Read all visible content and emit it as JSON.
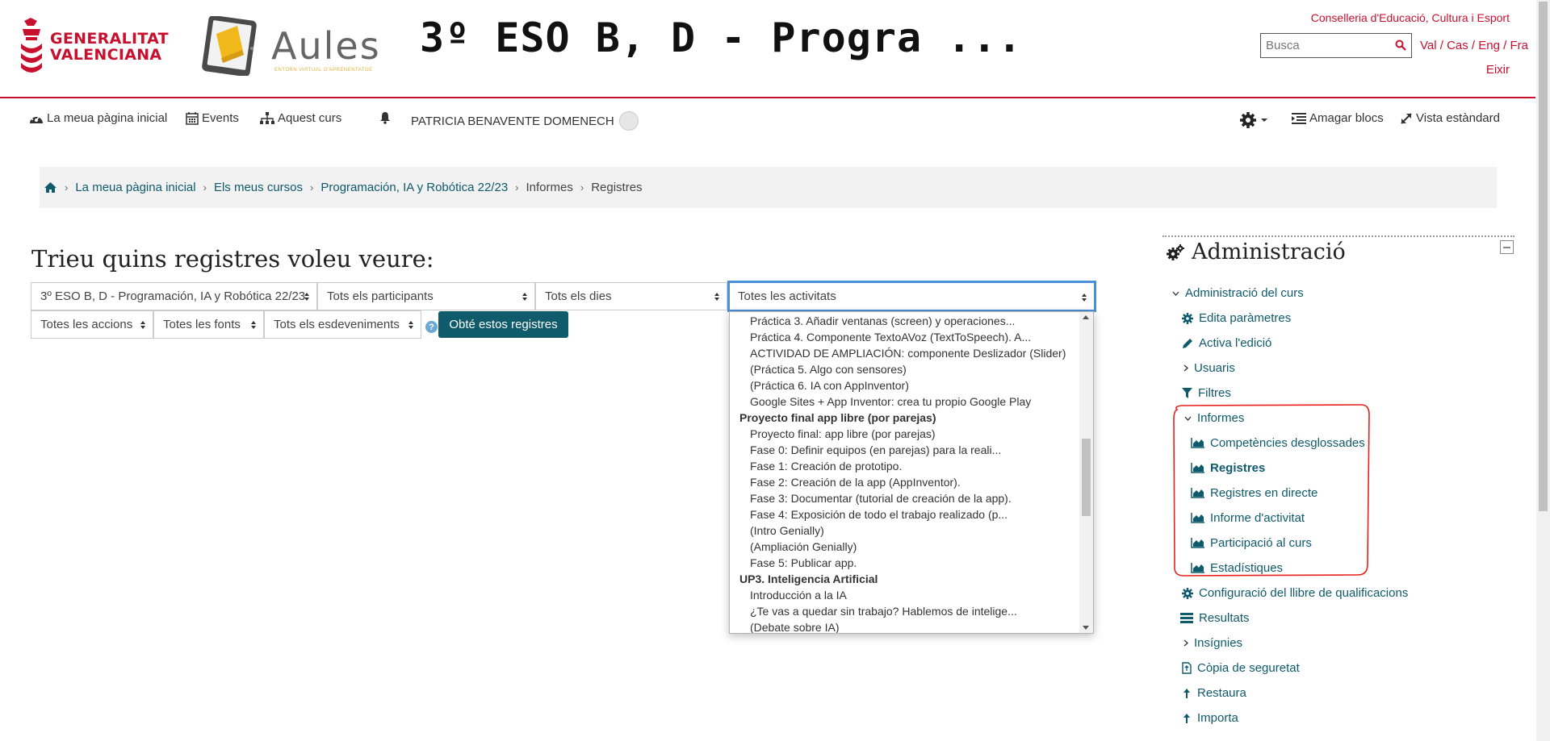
{
  "header": {
    "gv_logo_line1": "GENERALITAT",
    "gv_logo_line2": "VALENCIANA",
    "aules_word": "Aules",
    "aules_sub": "ENTORN VIRTUAL D'APRENENTATGE",
    "course_title": "3º ESO B, D - Progra ...",
    "conselleria": "Conselleria d'Educació, Cultura i Esport",
    "search_placeholder": "Busca",
    "lang_links": "Val / Cas / Eng / Fra",
    "logout": "Eixir"
  },
  "navbar": {
    "home": "La meua pàgina inicial",
    "events": "Events",
    "course": "Aquest curs",
    "user": "PATRICIA BENAVENTE DOMENECH",
    "hide_blocks": "Amagar blocs",
    "standard_view": "Vista estàndard"
  },
  "breadcrumb": [
    "La meua pàgina inicial",
    "Els meus cursos",
    "Programación, IA y Robótica 22/23",
    "Informes",
    "Registres"
  ],
  "main": {
    "heading": "Trieu quins registres voleu veure:",
    "selects": {
      "course": "3º ESO B, D - Programación, IA y Robótica 22/23",
      "participants": "Tots els participants",
      "days": "Tots els dies",
      "activities": "Totes les activitats",
      "actions": "Totes les accions",
      "sources": "Totes les fonts",
      "events": "Tots els esdeveniments"
    },
    "help": "?",
    "submit": "Obté estos registres"
  },
  "dropdown": {
    "items": [
      {
        "label": "Práctica 3. Añadir ventanas (screen) y operaciones...",
        "group": false
      },
      {
        "label": "Práctica 4. Componente TextoAVoz (TextToSpeech). A...",
        "group": false
      },
      {
        "label": "ACTIVIDAD DE AMPLIACIÓN: componente Deslizador (Slider)",
        "group": false
      },
      {
        "label": "(Práctica 5. Algo con sensores)",
        "group": false
      },
      {
        "label": "(Práctica 6. IA con AppInventor)",
        "group": false
      },
      {
        "label": "Google Sites + App Inventor: crea tu propio Google Play",
        "group": false
      },
      {
        "label": "Proyecto final app libre (por parejas)",
        "group": true
      },
      {
        "label": "Proyecto final: app libre (por parejas)",
        "group": false
      },
      {
        "label": "Fase 0: Definir equipos (en parejas) para la reali...",
        "group": false
      },
      {
        "label": "Fase 1: Creación de prototipo.",
        "group": false
      },
      {
        "label": "Fase 2: Creación de la app (AppInventor).",
        "group": false
      },
      {
        "label": "Fase 3: Documentar (tutorial de creación de la app).",
        "group": false
      },
      {
        "label": "Fase 4: Exposición de todo el trabajo realizado (p...",
        "group": false
      },
      {
        "label": "(Intro Genially)",
        "group": false
      },
      {
        "label": "(Ampliación Genially)",
        "group": false
      },
      {
        "label": "Fase 5: Publicar app.",
        "group": false
      },
      {
        "label": "UP3. Inteligencia Artificial",
        "group": true
      },
      {
        "label": "Introducción a la IA",
        "group": false
      },
      {
        "label": "¿Te vas a quedar sin trabajo? Hablemos de intelige...",
        "group": false
      },
      {
        "label": "(Debate sobre IA)",
        "group": false
      }
    ]
  },
  "admin": {
    "title": "Administració",
    "course_admin": "Administració del curs",
    "edit_params": "Edita paràmetres",
    "activate_edit": "Activa l'edició",
    "users": "Usuaris",
    "filters": "Filtres",
    "reports": "Informes",
    "report_items": [
      "Competències desglossades",
      "Registres",
      "Registres en directe",
      "Informe d'activitat",
      "Participació al curs",
      "Estadístiques"
    ],
    "gradebook_setup": "Configuració del llibre de qualificacions",
    "results": "Resultats",
    "badges": "Insígnies",
    "backup": "Còpia de seguretat",
    "restore": "Restaura",
    "import": "Importa"
  },
  "colors": {
    "brand_red": "#c8102e",
    "link_teal": "#0f5a6b",
    "focus_blue": "#4a90d9",
    "annotation_red": "#e8201a"
  }
}
